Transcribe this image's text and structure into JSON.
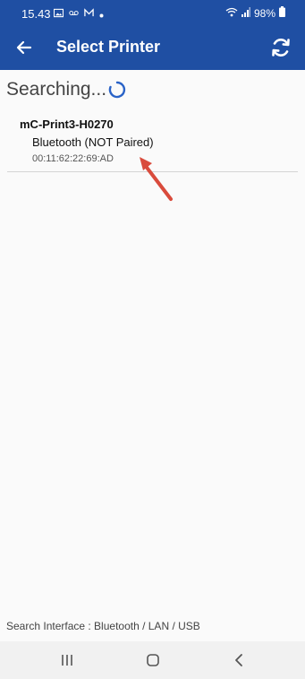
{
  "status_bar": {
    "time": "15.43",
    "battery": "98%",
    "icons": [
      "image-icon",
      "voicemail-icon",
      "mail-icon",
      "dot-icon",
      "wifi-icon",
      "signal-icon",
      "battery-icon"
    ]
  },
  "app_bar": {
    "title": "Select Printer",
    "back_icon": "back-arrow-icon",
    "refresh_icon": "refresh-icon"
  },
  "search": {
    "status_text": "Searching..."
  },
  "printers": [
    {
      "name": "mC-Print3-H0270",
      "connection": "Bluetooth (NOT Paired)",
      "address": "00:11:62:22:69:AD"
    }
  ],
  "footer": {
    "interface_text": "Search Interface :  Bluetooth / LAN / USB"
  },
  "colors": {
    "accent": "#1f4fa3",
    "annotation_arrow": "#d94b3c"
  }
}
